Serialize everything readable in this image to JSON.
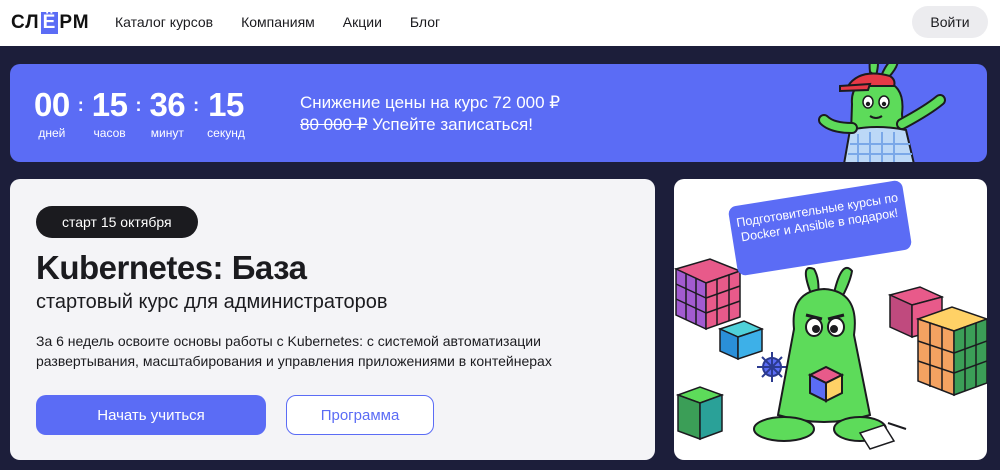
{
  "header": {
    "logo": {
      "pre": "СЛ",
      "highlight": "Ё",
      "post": "РМ"
    },
    "nav": [
      "Каталог курсов",
      "Компаниям",
      "Акции",
      "Блог"
    ],
    "login_label": "Войти"
  },
  "banner": {
    "countdown": [
      {
        "value": "00",
        "label": "дней"
      },
      {
        "value": "15",
        "label": "часов"
      },
      {
        "value": "36",
        "label": "минут"
      },
      {
        "value": "15",
        "label": "секунд"
      }
    ],
    "promo_line1": "Снижение цены на курс 72 000 ₽",
    "promo_old_price": "80 000 ₽",
    "promo_line2_rest": " Успейте записаться!"
  },
  "course": {
    "badge": "старт 15 октября",
    "title": "Kubernetes: База",
    "subtitle": "стартовый курс для администраторов",
    "description": "За 6 недель освоите основы работы с Kubernetes: с системой автоматизации развертывания, масштабирования и управления приложениями в контейнерах",
    "start_button": "Начать учиться",
    "program_button": "Программа"
  },
  "illustration": {
    "gift_text": "Подготовительные курсы по Docker и Ansible в подарок!"
  },
  "colors": {
    "accent": "#5b6cf5",
    "dark_bg": "#1c1e3a",
    "card_bg": "#f4f4f7",
    "mascot_green": "#5ddb5a"
  }
}
